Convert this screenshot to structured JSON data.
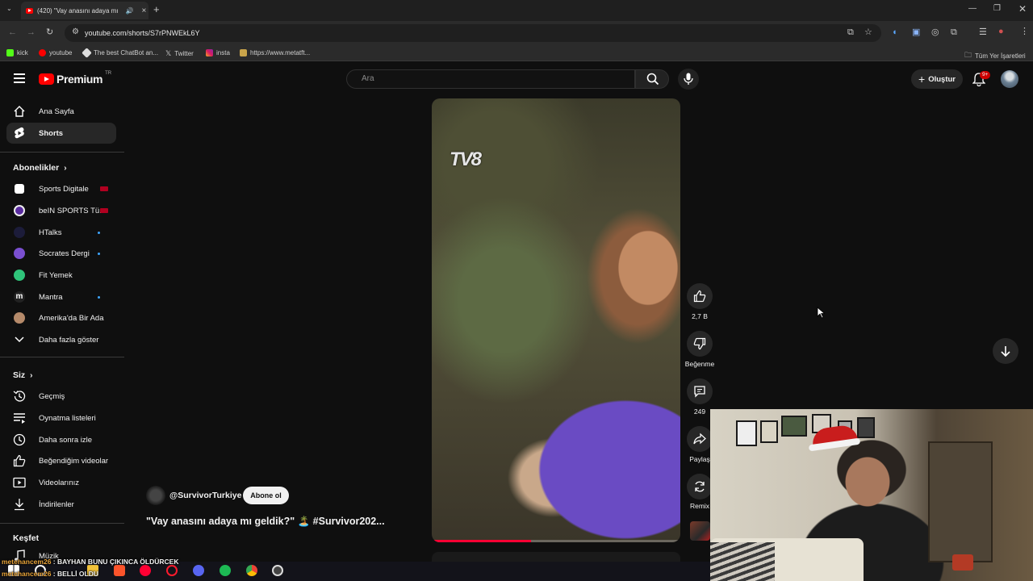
{
  "browser": {
    "tab_title": "(420) \"Vay anasını adaya mı",
    "url": "youtube.com/shorts/S7rPNWEkL6Y",
    "bookmarks": [
      "kick",
      "youtube",
      "The best ChatBot an...",
      "Twitter",
      "insta",
      "https://www.metatft..."
    ],
    "all_bookmarks": "Tüm Yer İşaretleri"
  },
  "header": {
    "logo_text": "Premium",
    "logo_country": "TR",
    "search_placeholder": "Ara",
    "create_label": "Oluştur",
    "notification_count": "9+"
  },
  "sidebar": {
    "main": [
      {
        "label": "Ana Sayfa",
        "icon": "home-icon"
      },
      {
        "label": "Shorts",
        "icon": "shorts-icon",
        "active": true
      }
    ],
    "subscriptions_title": "Abonelikler",
    "subscriptions": [
      {
        "label": "Sports Digitale",
        "color": "#ffffff",
        "status": "live"
      },
      {
        "label": "beIN SPORTS Tü...",
        "color": "#5a2ca0",
        "status": "live"
      },
      {
        "label": "HTalks",
        "color": "#1c1c3a",
        "status": "new"
      },
      {
        "label": "Socrates Dergi",
        "color": "#7a4fd0",
        "status": "new"
      },
      {
        "label": "Fit Yemek",
        "color": "#2fc47a",
        "status": "none"
      },
      {
        "label": "Mantra",
        "color": "#222222",
        "status": "new"
      },
      {
        "label": "Amerika'da Bir Ada",
        "color": "#b58a6a",
        "status": "none"
      }
    ],
    "show_more": "Daha fazla göster",
    "you_title": "Siz",
    "you_items": [
      {
        "label": "Geçmiş",
        "icon": "history-icon"
      },
      {
        "label": "Oynatma listeleri",
        "icon": "playlists-icon"
      },
      {
        "label": "Daha sonra izle",
        "icon": "watch-later-icon"
      },
      {
        "label": "Beğendiğim videolar",
        "icon": "liked-videos-icon"
      },
      {
        "label": "Videolarınız",
        "icon": "your-videos-icon"
      },
      {
        "label": "İndirilenler",
        "icon": "downloads-icon"
      }
    ],
    "explore_title": "Keşfet",
    "explore_items": [
      {
        "label": "Müzik",
        "icon": "music-icon"
      }
    ]
  },
  "short": {
    "watermark": "TV8",
    "progress": 0.4,
    "channel": "@SurvivorTurkiye",
    "subscribe_label": "Abone ol",
    "title": "\"Vay anasını adaya mı geldik?\" 🏝️ #Survivor202...",
    "actions": {
      "like_count": "2,7 B",
      "dislike_label": "Beğenme",
      "comment_count": "249",
      "share_label": "Paylaş",
      "remix_label": "Remix"
    }
  },
  "stream_overlay": {
    "chat": [
      {
        "user": "metehancem26",
        "message": "BAYHAN BUNU ÇIKINCA ÖLDÜRCEK"
      },
      {
        "user": "metehancem26",
        "message": "BELLİ OLDU"
      }
    ]
  }
}
